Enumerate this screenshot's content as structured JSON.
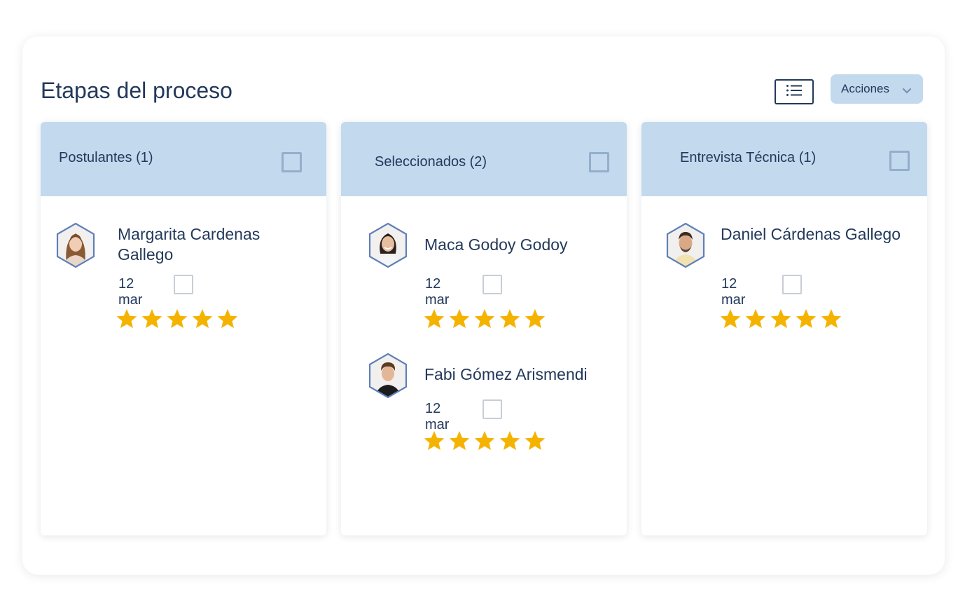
{
  "header": {
    "title": "Etapas del proceso",
    "view_toggle_icon": "list-icon",
    "actions_label": "Acciones"
  },
  "colors": {
    "accent": "#c2d9ee",
    "text": "#23395b",
    "star": "#f5b301"
  },
  "columns": [
    {
      "title": "Postulantes (1)",
      "candidates": [
        {
          "name": "Margarita Cardenas Gallego",
          "date": "12 mar",
          "rating": 5,
          "avatar": "female-portrait-1"
        }
      ]
    },
    {
      "title": "Seleccionados (2)",
      "candidates": [
        {
          "name": "Maca Godoy Godoy",
          "date": "12 mar",
          "rating": 5,
          "avatar": "female-portrait-2"
        },
        {
          "name": "Fabi Gómez Arismendi",
          "date": "12 mar",
          "rating": 5,
          "avatar": "male-portrait-1"
        }
      ]
    },
    {
      "title": "Entrevista Técnica (1)",
      "candidates": [
        {
          "name": "Daniel Cárdenas Gallego",
          "date": "12 mar",
          "rating": 5,
          "avatar": "male-portrait-2"
        }
      ]
    }
  ]
}
